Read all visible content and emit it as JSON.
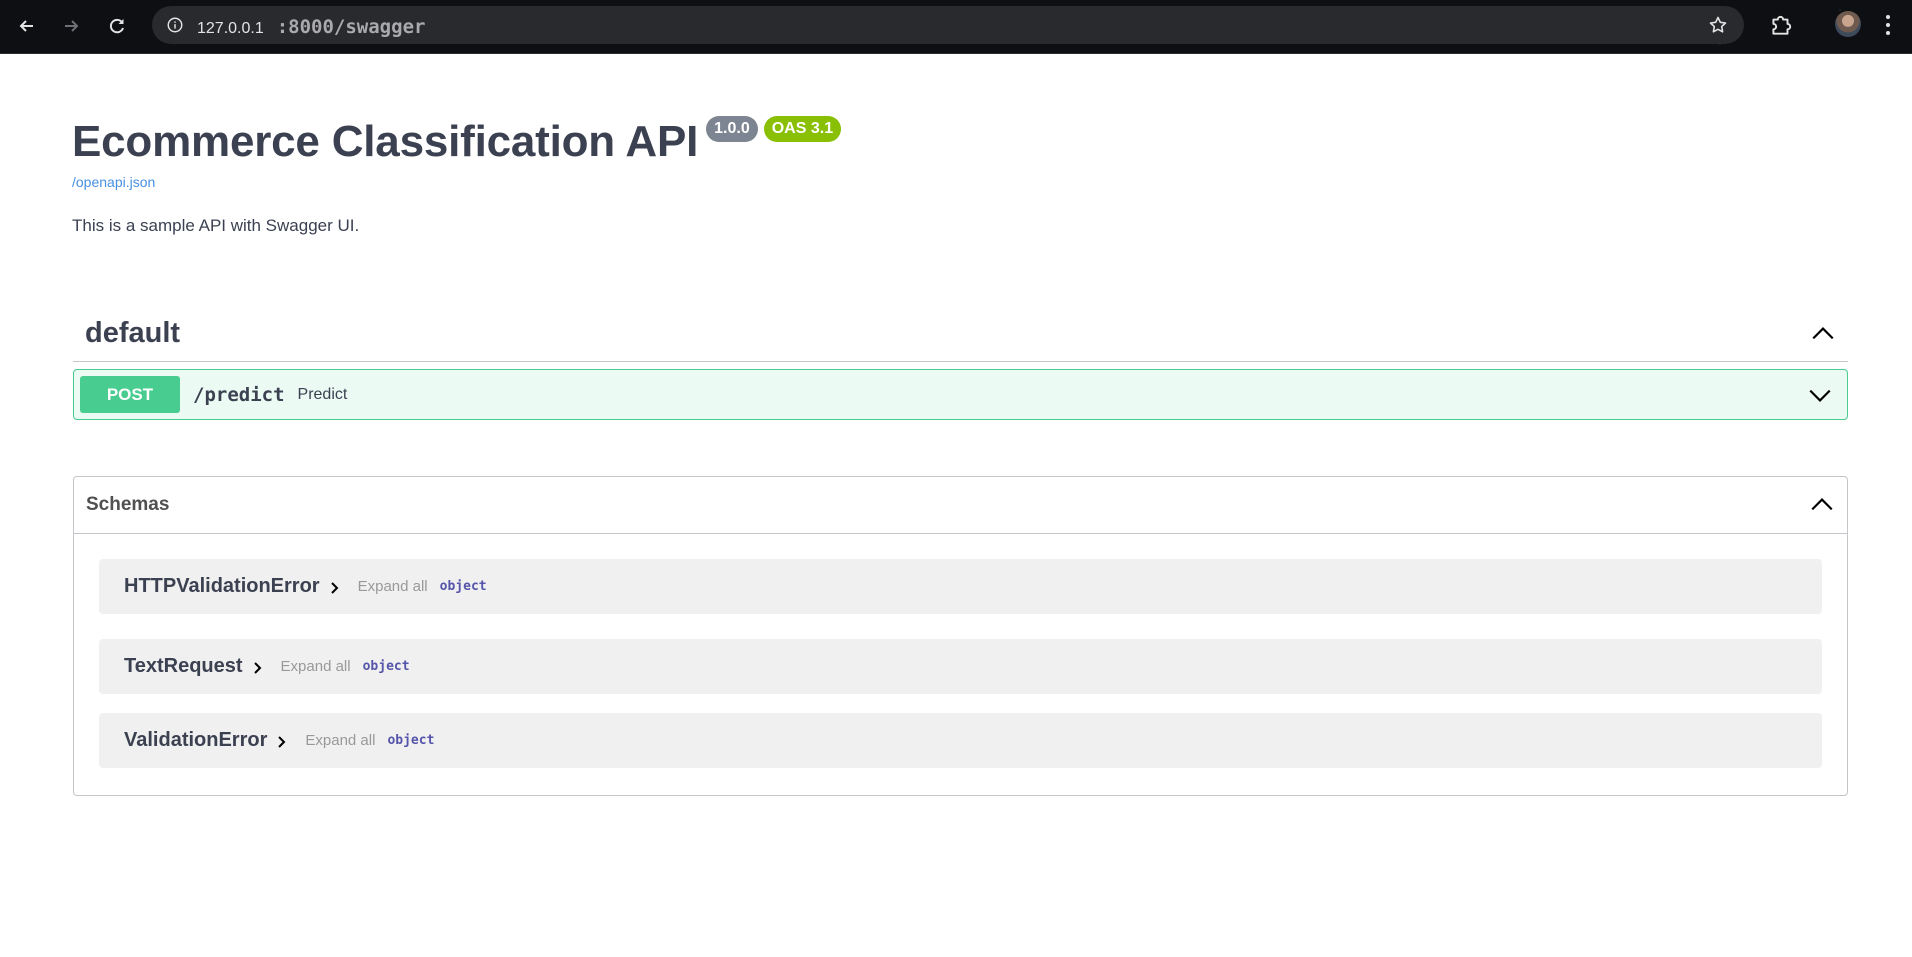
{
  "browser": {
    "url_host": "127.0.0.1",
    "url_rest": ":8000/swagger"
  },
  "info": {
    "title": "Ecommerce Classification API",
    "version": "1.0.0",
    "oas": "OAS 3.1",
    "spec_link": "/openapi.json",
    "description": "This is a sample API with Swagger UI."
  },
  "tag": {
    "name": "default",
    "operations": [
      {
        "method": "POST",
        "path": "/predict",
        "summary": "Predict"
      }
    ]
  },
  "schemas": {
    "title": "Schemas",
    "models": [
      {
        "name": "HTTPValidationError",
        "expand": "Expand all",
        "type": "object"
      },
      {
        "name": "TextRequest",
        "expand": "Expand all",
        "type": "object"
      },
      {
        "name": "ValidationError",
        "expand": "Expand all",
        "type": "object"
      }
    ]
  },
  "colors": {
    "post": "#49cc90",
    "version_badge": "#7d8492",
    "oas_badge": "#89bf04",
    "link": "#4990e2"
  }
}
